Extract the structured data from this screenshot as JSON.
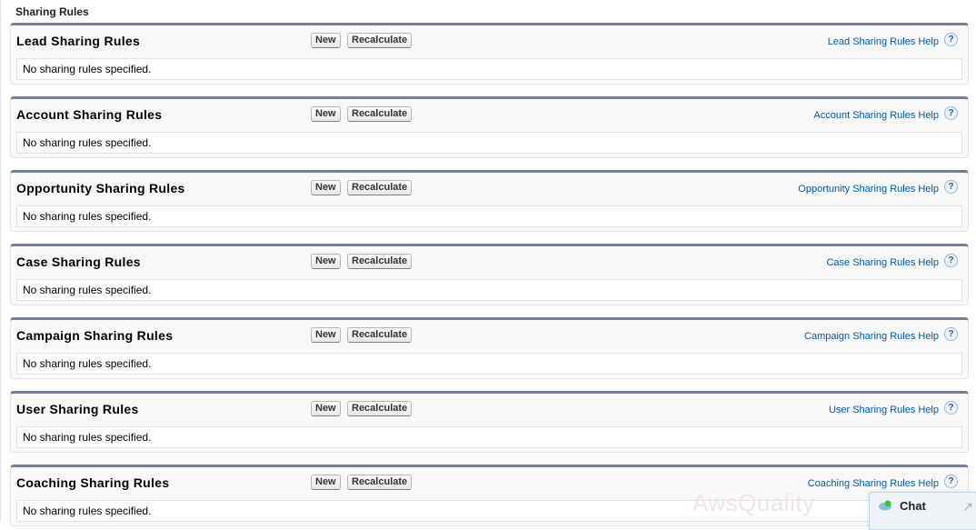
{
  "page": {
    "title": "Sharing Rules"
  },
  "sections": [
    {
      "title": "Lead Sharing Rules",
      "new_label": "New",
      "recalc_label": "Recalculate",
      "help_label": "Lead Sharing Rules Help",
      "help_icon": "?",
      "body": "No sharing rules specified."
    },
    {
      "title": "Account Sharing Rules",
      "new_label": "New",
      "recalc_label": "Recalculate",
      "help_label": "Account Sharing Rules Help",
      "help_icon": "?",
      "body": "No sharing rules specified."
    },
    {
      "title": "Opportunity Sharing Rules",
      "new_label": "New",
      "recalc_label": "Recalculate",
      "help_label": "Opportunity Sharing Rules Help",
      "help_icon": "?",
      "body": "No sharing rules specified."
    },
    {
      "title": "Case Sharing Rules",
      "new_label": "New",
      "recalc_label": "Recalculate",
      "help_label": "Case Sharing Rules Help",
      "help_icon": "?",
      "body": "No sharing rules specified."
    },
    {
      "title": "Campaign Sharing Rules",
      "new_label": "New",
      "recalc_label": "Recalculate",
      "help_label": "Campaign Sharing Rules Help",
      "help_icon": "?",
      "body": "No sharing rules specified."
    },
    {
      "title": "User Sharing Rules",
      "new_label": "New",
      "recalc_label": "Recalculate",
      "help_label": "User Sharing Rules Help",
      "help_icon": "?",
      "body": "No sharing rules specified."
    },
    {
      "title": "Coaching Sharing Rules",
      "new_label": "New",
      "recalc_label": "Recalculate",
      "help_label": "Coaching Sharing Rules Help",
      "help_icon": "?",
      "body": "No sharing rules specified."
    }
  ],
  "watermark": "AwsQuality",
  "chat": {
    "label": "Chat",
    "arrow": "↗"
  }
}
